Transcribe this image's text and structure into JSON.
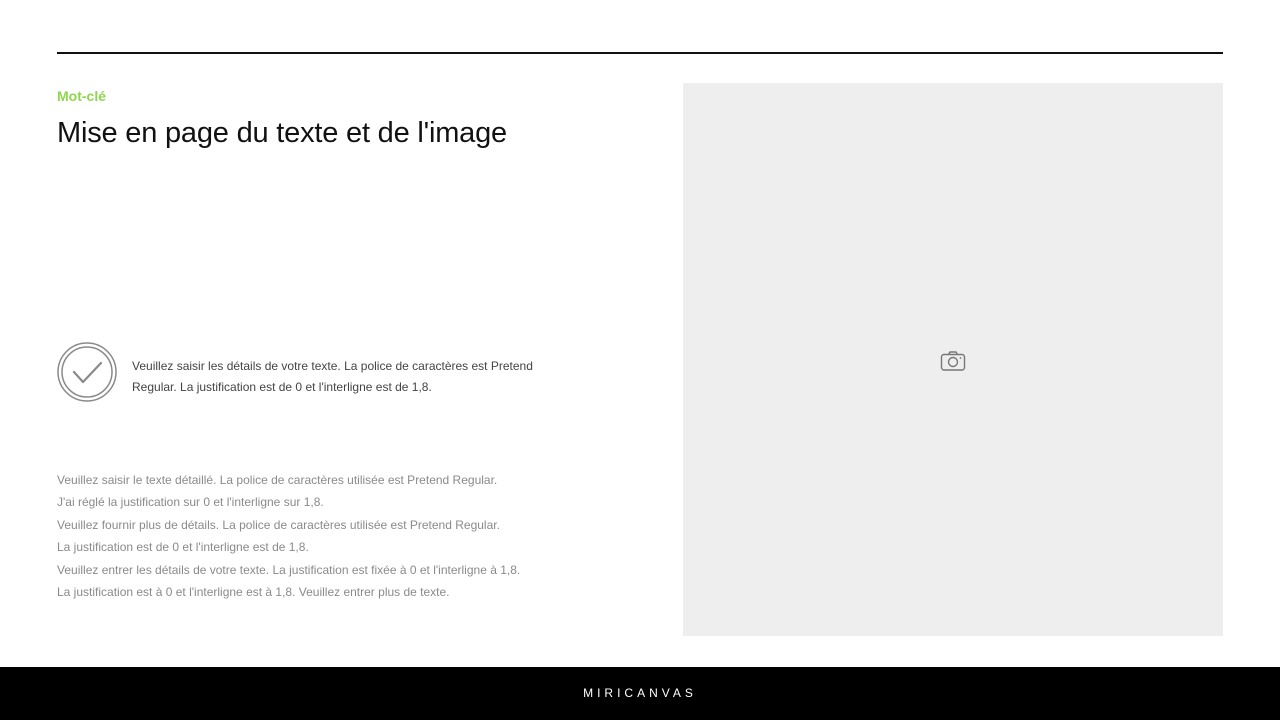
{
  "header": {
    "keyword": "Mot-clé",
    "title": "Mise en page du texte et de l'image"
  },
  "feature": {
    "icon": "check-circle-icon",
    "text": "Veuillez saisir les détails de votre texte. La police de caractères est Pretend Regular. La justification est de 0 et l'interligne est de 1,8."
  },
  "body": {
    "lines": [
      "Veuillez saisir le texte détaillé. La police de caractères utilisée est Pretend Regular.",
      "J'ai réglé la justification sur 0 et l'interligne sur 1,8.",
      "Veuillez fournir plus de détails. La police de caractères utilisée est Pretend Regular.",
      "La justification est de 0 et l'interligne est de 1,8.",
      "Veuillez entrer les détails de votre texte. La justification est fixée à 0 et l'interligne à 1,8.",
      "La justification est à 0 et l'interligne est à 1,8. Veuillez entrer plus de texte."
    ]
  },
  "image": {
    "icon": "camera-icon"
  },
  "footer": {
    "brand": "MIRICANVAS"
  },
  "colors": {
    "accent": "#8ed64f",
    "text_dark": "#111111",
    "text_muted": "#8a8a8a",
    "placeholder": "#eeeeee",
    "footer_bg": "#000000"
  }
}
